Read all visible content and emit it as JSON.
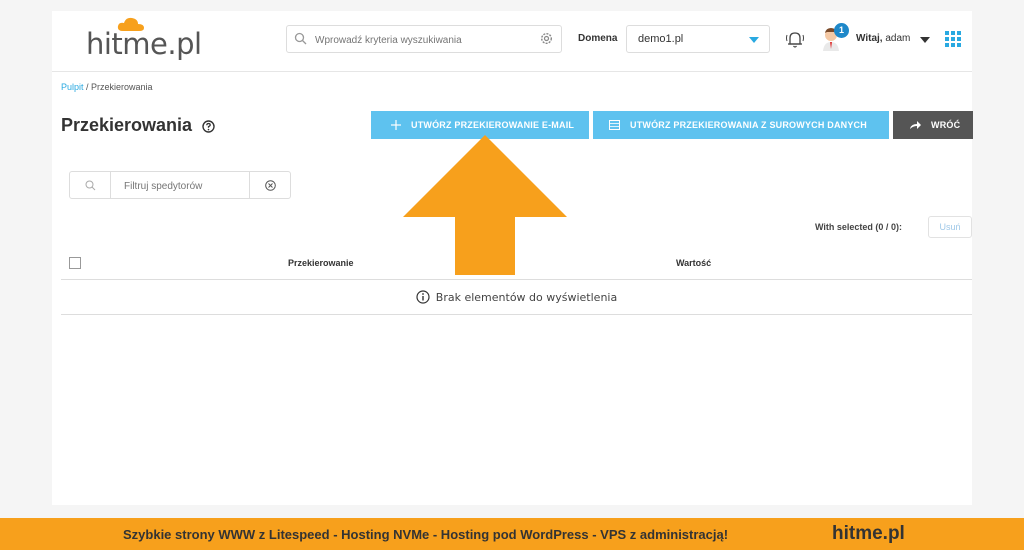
{
  "header": {
    "logo_text": "hitme.pl",
    "search_placeholder": "Wprowadź kryteria wyszukiwania",
    "domain_label": "Domena",
    "domain_value": "demo1.pl",
    "notification_count": "1",
    "greeting_bold": "Witaj,",
    "greeting_user": "adam"
  },
  "breadcrumb": {
    "home": "Pulpit",
    "separator": " / ",
    "current": "Przekierowania"
  },
  "page": {
    "title": "Przekierowania",
    "btn_create_email": "UTWÓRZ PRZEKIEROWANIE E-MAIL",
    "btn_create_raw": "UTWÓRZ PRZEKIEROWANIA Z SUROWYCH DANYCH",
    "btn_back": "WRÓĆ"
  },
  "filter": {
    "placeholder": "Filtruj spedytorów"
  },
  "table": {
    "with_selected": "With selected (0 / 0):",
    "delete_label": "Usuń",
    "columns": [
      "Przekierowanie",
      "Wartość"
    ],
    "empty_message": "Brak elementów do wyświetlenia"
  },
  "footer": {
    "text": "Szybkie strony WWW z Litespeed - Hosting  NVMe - Hosting pod WordPress - VPS z administracją!",
    "brand": "hitme.pl"
  },
  "colors": {
    "accent": "#5ec2ef",
    "arrow": "#f7a01c",
    "footer": "#f7a01c",
    "back_button": "#555555"
  }
}
